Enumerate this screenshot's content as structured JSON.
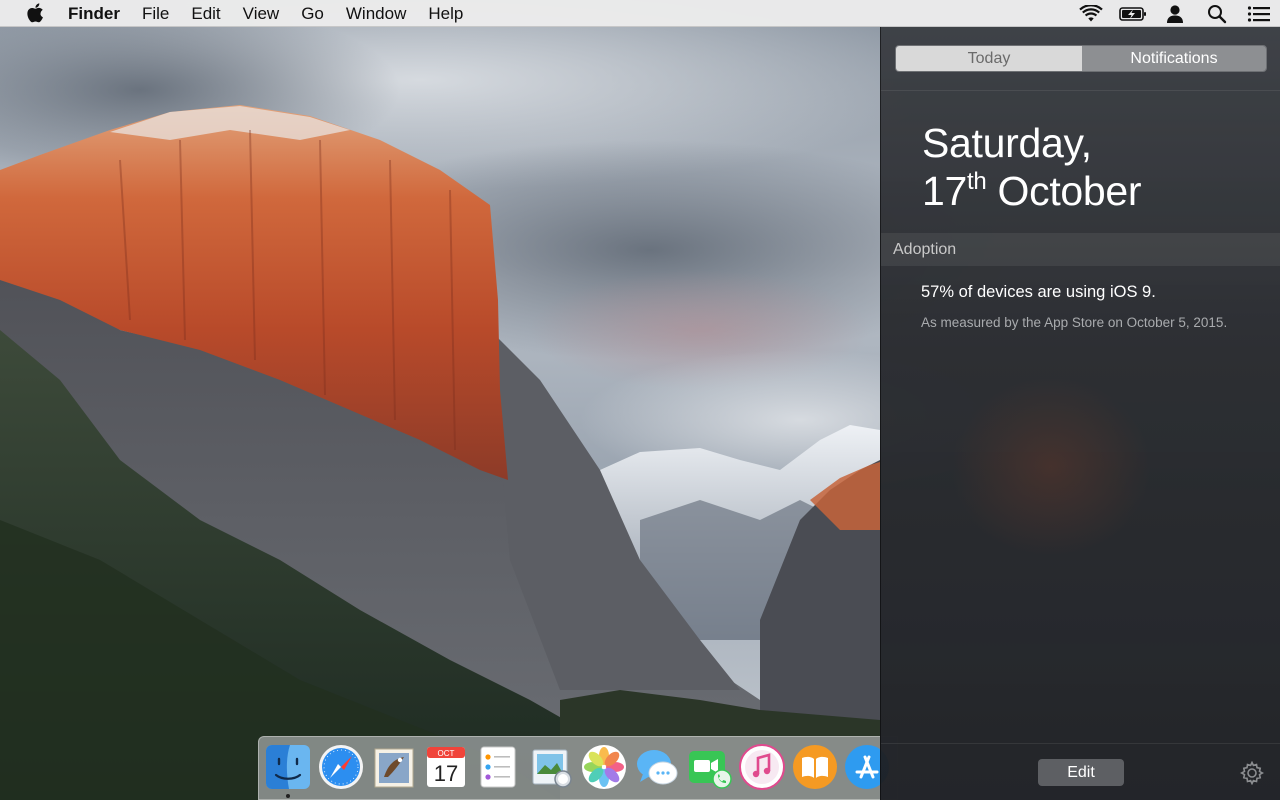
{
  "menubar": {
    "apple_icon": "apple-logo-icon",
    "app_name": "Finder",
    "items": [
      "File",
      "Edit",
      "View",
      "Go",
      "Window",
      "Help"
    ],
    "status_icons": [
      "wifi-icon",
      "battery-charging-icon",
      "user-icon",
      "spotlight-search-icon",
      "notification-center-icon"
    ]
  },
  "notification_center": {
    "tabs": [
      "Today",
      "Notifications"
    ],
    "selected_tab": "Notifications",
    "date_line1": "Saturday,",
    "date_day": "17",
    "date_suffix": "th",
    "date_month": "October",
    "section": "Adoption",
    "notification": {
      "title": "57% of devices are using iOS 9.",
      "body": "As measured by the App Store on October 5, 2015."
    },
    "edit_label": "Edit",
    "settings_icon": "gear-icon"
  },
  "dock": {
    "apps": [
      {
        "name": "finder-icon",
        "running": true
      },
      {
        "name": "safari-icon",
        "running": false
      },
      {
        "name": "mail-icon",
        "running": false
      },
      {
        "name": "calendar-icon",
        "running": false,
        "month": "OCT",
        "day": "17"
      },
      {
        "name": "reminders-icon",
        "running": false
      },
      {
        "name": "preview-icon",
        "running": false
      },
      {
        "name": "photos-icon",
        "running": false
      },
      {
        "name": "messages-icon",
        "running": false
      },
      {
        "name": "facetime-icon",
        "running": false
      },
      {
        "name": "itunes-icon",
        "running": false
      },
      {
        "name": "ibooks-icon",
        "running": false
      },
      {
        "name": "app-store-icon",
        "running": false
      }
    ]
  },
  "colors": {
    "menubar_bg": "#ececec",
    "panel_bg": "#2e3034",
    "tab_selected_bg": "#8d8f92",
    "tab_unselected_bg": "#d9d9d9",
    "edit_button_bg": "#5d5f63"
  }
}
